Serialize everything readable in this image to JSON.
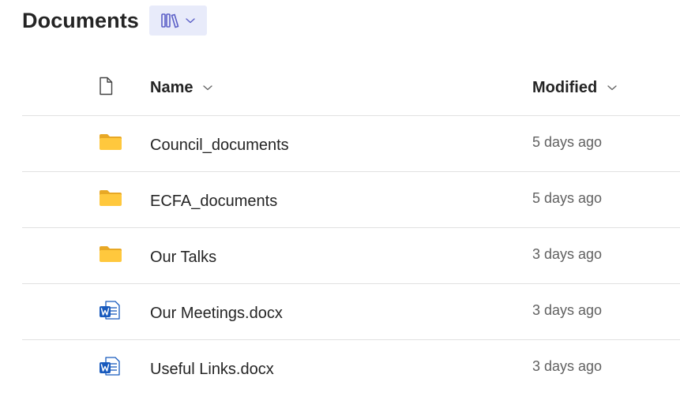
{
  "page": {
    "title": "Documents"
  },
  "view_switch": {
    "icon": "library-view-icon",
    "dropdown_icon": "chevron-down-icon"
  },
  "columns": {
    "type_icon": "document-icon",
    "name": "Name",
    "modified": "Modified"
  },
  "rows": [
    {
      "type": "folder",
      "icon": "folder-icon",
      "name": "Council_documents",
      "modified": "5 days ago"
    },
    {
      "type": "folder",
      "icon": "folder-icon",
      "name": "ECFA_documents",
      "modified": "5 days ago"
    },
    {
      "type": "folder",
      "icon": "folder-icon",
      "name": "Our Talks",
      "modified": "3 days ago"
    },
    {
      "type": "docx",
      "icon": "word-document-icon",
      "name": "Our Meetings.docx",
      "modified": "3 days ago"
    },
    {
      "type": "docx",
      "icon": "word-document-icon",
      "name": "Useful Links.docx",
      "modified": "3 days ago"
    }
  ],
  "colors": {
    "folder": "#ffc83d",
    "folder_tab": "#e8a825",
    "word_blue": "#185abd",
    "view_switch_bg": "#e8ebfa"
  }
}
